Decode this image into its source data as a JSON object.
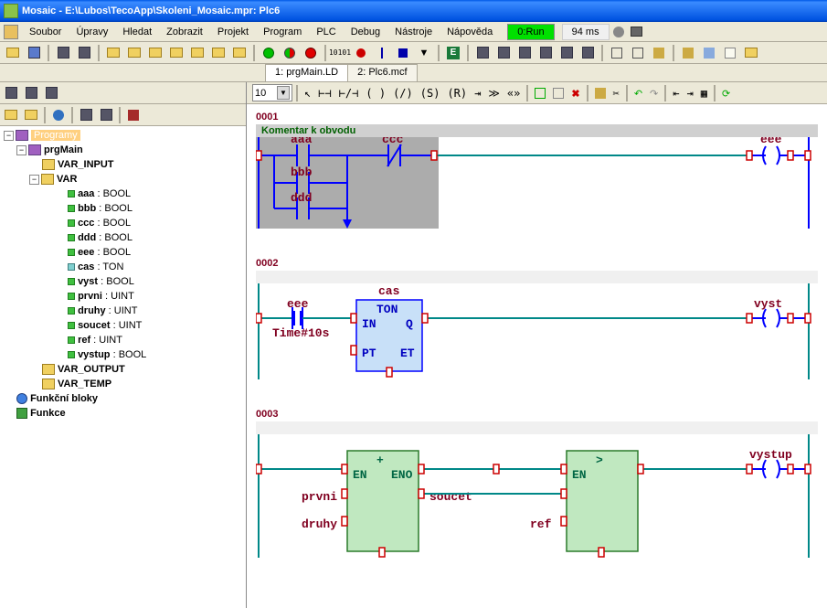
{
  "title": "Mosaic - E:\\Lubos\\TecoApp\\Skoleni_Mosaic.mpr: Plc6",
  "menu": [
    "Soubor",
    "Úpravy",
    "Hledat",
    "Zobrazit",
    "Projekt",
    "Program",
    "PLC",
    "Debug",
    "Nástroje",
    "Nápověda"
  ],
  "run_status": "0:Run",
  "time_status": "94 ms",
  "tabs": [
    "1: prgMain.LD",
    "2: Plc6.mcf"
  ],
  "tree": {
    "root": "Programy",
    "prgMain": "prgMain",
    "var_input": "VAR_INPUT",
    "var": "VAR",
    "vars": [
      {
        "name": "aaa",
        "type": "BOOL"
      },
      {
        "name": "bbb",
        "type": "BOOL"
      },
      {
        "name": "ccc",
        "type": "BOOL"
      },
      {
        "name": "ddd",
        "type": "BOOL"
      },
      {
        "name": "eee",
        "type": "BOOL"
      },
      {
        "name": "cas",
        "type": "TON"
      },
      {
        "name": "vyst",
        "type": "BOOL"
      },
      {
        "name": "prvni",
        "type": "UINT"
      },
      {
        "name": "druhy",
        "type": "UINT"
      },
      {
        "name": "soucet",
        "type": "UINT"
      },
      {
        "name": "ref",
        "type": "UINT"
      },
      {
        "name": "vystup",
        "type": "BOOL"
      }
    ],
    "var_output": "VAR_OUTPUT",
    "var_temp": "VAR_TEMP",
    "func_blocks": "Funkční bloky",
    "funcs": "Funkce"
  },
  "zoom": "10",
  "rung1": {
    "num": "0001",
    "comment": "Komentar k obvodu",
    "labels": {
      "aaa": "aaa",
      "bbb": "bbb",
      "ccc": "ccc",
      "ddd": "ddd",
      "eee": "eee"
    }
  },
  "rung2": {
    "num": "0002",
    "labels": {
      "cas": "cas",
      "eee": "eee",
      "time": "Time#10s",
      "vyst": "vyst",
      "ton": "TON",
      "in": "IN",
      "q": "Q",
      "pt": "PT",
      "et": "ET"
    }
  },
  "rung3": {
    "num": "0003",
    "labels": {
      "plus": "+",
      "en1": "EN",
      "eno": "ENO",
      "gt": ">",
      "en2": "EN",
      "prvni": "prvni",
      "druhy": "druhy",
      "soucet": "soucet",
      "ref": "ref",
      "vystup": "vystup"
    }
  }
}
